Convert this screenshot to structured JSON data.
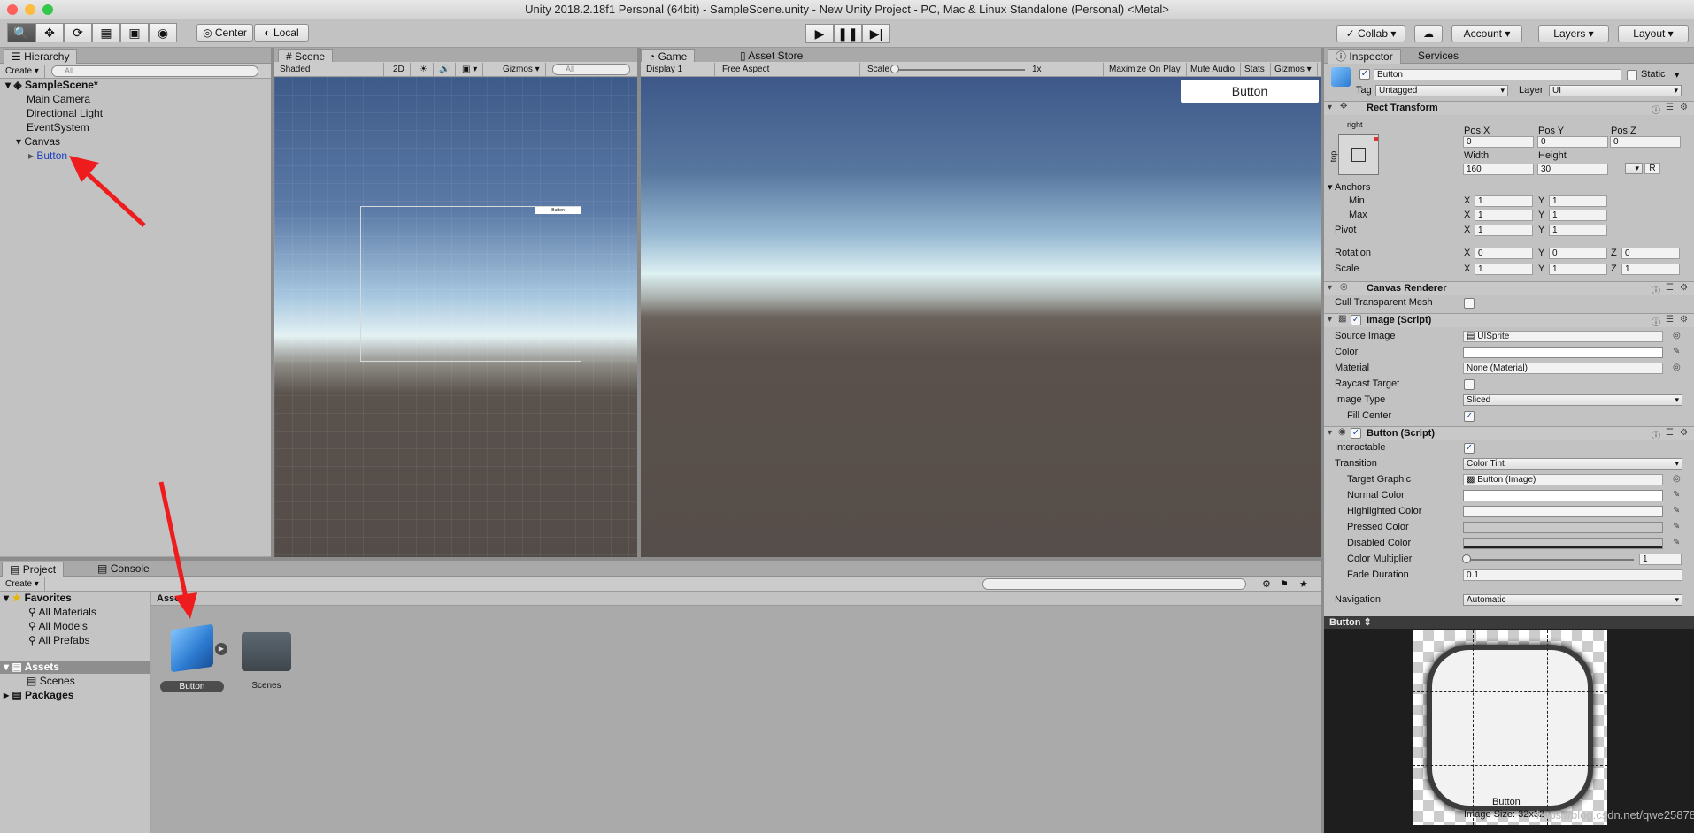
{
  "window": {
    "title": "Unity 2018.2.18f1 Personal (64bit) - SampleScene.unity - New Unity Project - PC, Mac & Linux Standalone (Personal) <Metal>"
  },
  "toolbar": {
    "center": "Center",
    "local": "Local",
    "collab": "Collab",
    "account": "Account",
    "layers": "Layers",
    "layout": "Layout",
    "play_icon": "play-icon",
    "pause_icon": "pause-icon",
    "step_icon": "step-icon"
  },
  "hierarchy": {
    "tab": "Hierarchy",
    "create": "Create",
    "search_placeholder": "All",
    "scene": "SampleScene*",
    "items": [
      "Main Camera",
      "Directional Light",
      "EventSystem",
      "Canvas",
      "Button"
    ]
  },
  "scene": {
    "tab": "Scene",
    "shading": "Shaded",
    "mode2d": "2D",
    "gizmos": "Gizmos",
    "search_placeholder": "All",
    "canvas_button_label": "Button"
  },
  "game": {
    "tab": "Game",
    "asset_store_tab": "Asset Store",
    "display": "Display 1",
    "aspect": "Free Aspect",
    "scale_label": "Scale",
    "scale_value": "1x",
    "maximize": "Maximize On Play",
    "mute": "Mute Audio",
    "stats": "Stats",
    "gizmos": "Gizmos",
    "button_label": "Button"
  },
  "project": {
    "tab": "Project",
    "console_tab": "Console",
    "create": "Create",
    "favorites": "Favorites",
    "fav_items": [
      "All Materials",
      "All Models",
      "All Prefabs"
    ],
    "assets": "Assets",
    "scenes": "Scenes",
    "packages": "Packages",
    "breadcrumb": "Assets",
    "tiles": [
      "Button",
      "Scenes"
    ]
  },
  "inspector": {
    "tab": "Inspector",
    "services_tab": "Services",
    "object_name": "Button",
    "static": "Static",
    "tag_label": "Tag",
    "tag_value": "Untagged",
    "layer_label": "Layer",
    "layer_value": "UI",
    "rect": {
      "title": "Rect Transform",
      "anchor_h": "right",
      "anchor_v": "top",
      "pos_x_label": "Pos X",
      "pos_y_label": "Pos Y",
      "pos_z_label": "Pos Z",
      "pos_x": "0",
      "pos_y": "0",
      "pos_z": "0",
      "width_label": "Width",
      "height_label": "Height",
      "width": "160",
      "height": "30",
      "r_button": "R",
      "anchors": "Anchors",
      "min": "Min",
      "max": "Max",
      "pivot": "Pivot",
      "min_x": "1",
      "min_y": "1",
      "max_x": "1",
      "max_y": "1",
      "pivot_x": "1",
      "pivot_y": "1",
      "rotation": "Rotation",
      "scale": "Scale",
      "rot_x": "0",
      "rot_y": "0",
      "rot_z": "0",
      "scale_x": "1",
      "scale_y": "1",
      "scale_z": "1",
      "x": "X",
      "y": "Y",
      "z": "Z"
    },
    "canvas_renderer": {
      "title": "Canvas Renderer",
      "cull": "Cull Transparent Mesh"
    },
    "image": {
      "title": "Image (Script)",
      "source_image_label": "Source Image",
      "source_image": "UISprite",
      "color_label": "Color",
      "material_label": "Material",
      "material": "None (Material)",
      "raycast_label": "Raycast Target",
      "image_type_label": "Image Type",
      "image_type": "Sliced",
      "fill_center_label": "Fill Center"
    },
    "button": {
      "title": "Button (Script)",
      "interactable_label": "Interactable",
      "transition_label": "Transition",
      "transition": "Color Tint",
      "target_graphic_label": "Target Graphic",
      "target_graphic": "Button (Image)",
      "normal_color": "Normal Color",
      "highlighted_color": "Highlighted Color",
      "pressed_color": "Pressed Color",
      "disabled_color": "Disabled Color",
      "color_multiplier_label": "Color Multiplier",
      "color_multiplier": "1",
      "fade_duration_label": "Fade Duration",
      "fade_duration": "0.1"
    },
    "navigation_label": "Navigation",
    "navigation": "Automatic",
    "preview": {
      "title": "Button",
      "caption": "Button",
      "image_size": "Image Size: 32x32",
      "watermark": "https://blog.csdn.net/qwe25878"
    }
  }
}
